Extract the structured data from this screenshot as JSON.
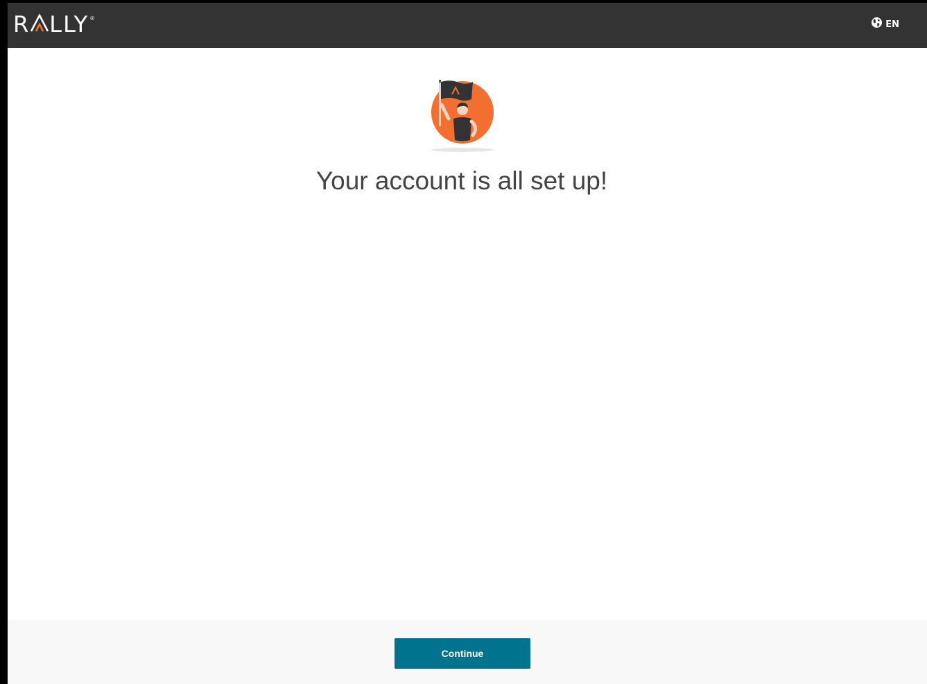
{
  "header": {
    "logo_text_left": "R",
    "logo_text_right": "LLY",
    "logo_reg_mark": "®",
    "language_icon": "globe-icon",
    "language_code": "EN"
  },
  "hero": {
    "illustration": "flag-bearer-illustration"
  },
  "main": {
    "title": "Your account is all set up!"
  },
  "footer": {
    "continue_label": "Continue"
  },
  "colors": {
    "header_bg": "#333333",
    "brand_orange": "#f36f2f",
    "button_bg": "#00738f",
    "footer_bg": "#f8f8f8",
    "title_text": "#444444"
  }
}
